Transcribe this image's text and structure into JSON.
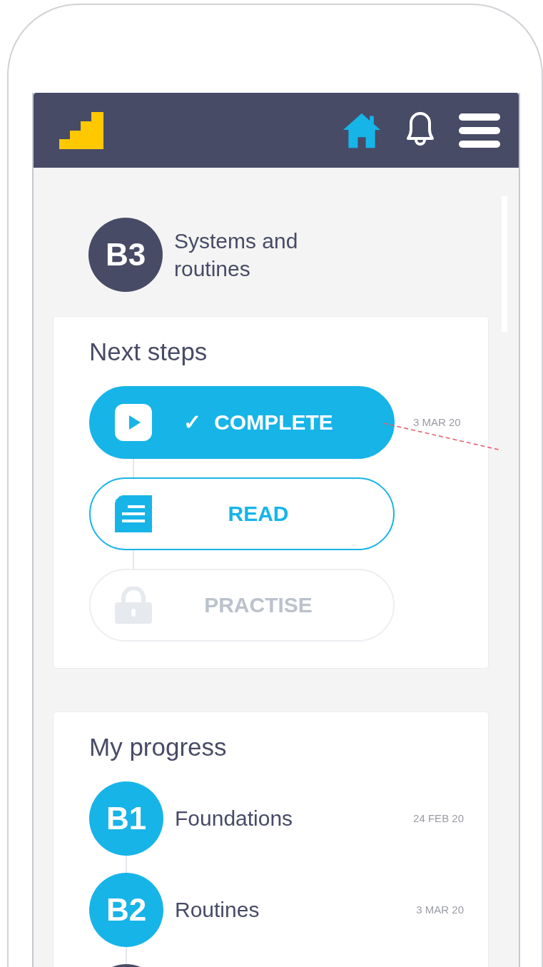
{
  "current_module": {
    "badge": "B3",
    "title": "Systems and routines"
  },
  "next_steps": {
    "title": "Next steps",
    "steps": [
      {
        "kind": "video",
        "completed": true,
        "locked": false,
        "label": "COMPLETE",
        "check": "✓",
        "date": "3 MAR 20"
      },
      {
        "kind": "read",
        "completed": false,
        "locked": false,
        "label": "READ"
      },
      {
        "kind": "practise",
        "completed": false,
        "locked": true,
        "label": "PRACTISE"
      }
    ]
  },
  "progress": {
    "title": "My progress",
    "modules": [
      {
        "completed": true,
        "badge": "B1",
        "title": "Foundations",
        "date": "24 FEB 20"
      },
      {
        "completed": true,
        "badge": "B2",
        "title": "Routines",
        "date": "3 MAR 20"
      },
      {
        "completed": false
      }
    ]
  }
}
